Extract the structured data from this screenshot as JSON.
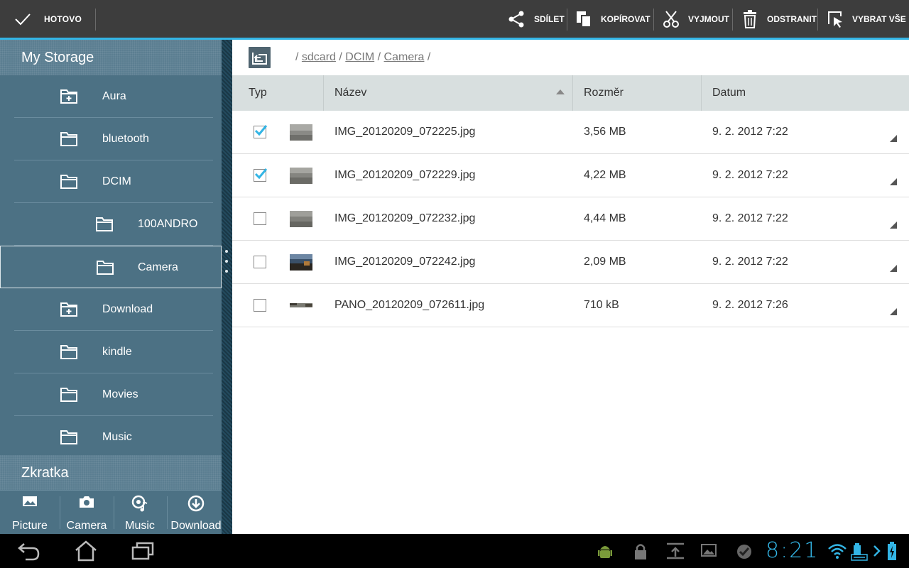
{
  "actionbar": {
    "done_label": "HOTOVO",
    "actions": [
      {
        "label": "SDÍLET",
        "icon": "share-icon"
      },
      {
        "label": "KOPÍROVAT",
        "icon": "copy-icon"
      },
      {
        "label": "VYJMOUT",
        "icon": "scissors-icon"
      },
      {
        "label": "ODSTRANIT",
        "icon": "trash-icon"
      },
      {
        "label": "VYBRAT VŠE",
        "icon": "select-all-icon"
      }
    ],
    "accent_color": "#33b5e5"
  },
  "sidebar": {
    "storage_title": "My Storage",
    "folders": [
      {
        "label": "Aura",
        "icon": "folder-plus-icon"
      },
      {
        "label": "bluetooth",
        "icon": "folder-icon"
      },
      {
        "label": "DCIM",
        "icon": "folder-icon"
      },
      {
        "label": "100ANDRO",
        "icon": "folder-icon"
      },
      {
        "label": "Camera",
        "icon": "folder-icon",
        "selected": true
      },
      {
        "label": "Download",
        "icon": "folder-plus-icon"
      },
      {
        "label": "kindle",
        "icon": "folder-icon"
      },
      {
        "label": "Movies",
        "icon": "folder-icon"
      },
      {
        "label": "Music",
        "icon": "folder-icon"
      }
    ],
    "shortcuts_title": "Zkratka",
    "shortcuts": [
      {
        "label": "Picture",
        "icon": "picture-icon"
      },
      {
        "label": "Camera",
        "icon": "camera-icon"
      },
      {
        "label": "Music",
        "icon": "music-icon"
      },
      {
        "label": "Download",
        "icon": "download-icon"
      }
    ]
  },
  "path": {
    "root_sep": "/",
    "crumbs": [
      "sdcard",
      "DCIM",
      "Camera"
    ],
    "sep": "/"
  },
  "table": {
    "headers": {
      "type": "Typ",
      "name": "Název",
      "size": "Rozměr",
      "date": "Datum"
    },
    "rows": [
      {
        "checked": true,
        "name": "IMG_20120209_072225.jpg",
        "size": "3,56 MB",
        "date": "9. 2. 2012 7:22"
      },
      {
        "checked": true,
        "name": "IMG_20120209_072229.jpg",
        "size": "4,22 MB",
        "date": "9. 2. 2012 7:22"
      },
      {
        "checked": false,
        "name": "IMG_20120209_072232.jpg",
        "size": "4,44 MB",
        "date": "9. 2. 2012 7:22"
      },
      {
        "checked": false,
        "name": "IMG_20120209_072242.jpg",
        "size": "2,09 MB",
        "date": "9. 2. 2012 7:22"
      },
      {
        "checked": false,
        "name": "PANO_20120209_072611.jpg",
        "size": "710 kB",
        "date": "9. 2. 2012 7:26"
      }
    ]
  },
  "systembar": {
    "clock": "8:21",
    "clock_color": "#33b5e5"
  }
}
